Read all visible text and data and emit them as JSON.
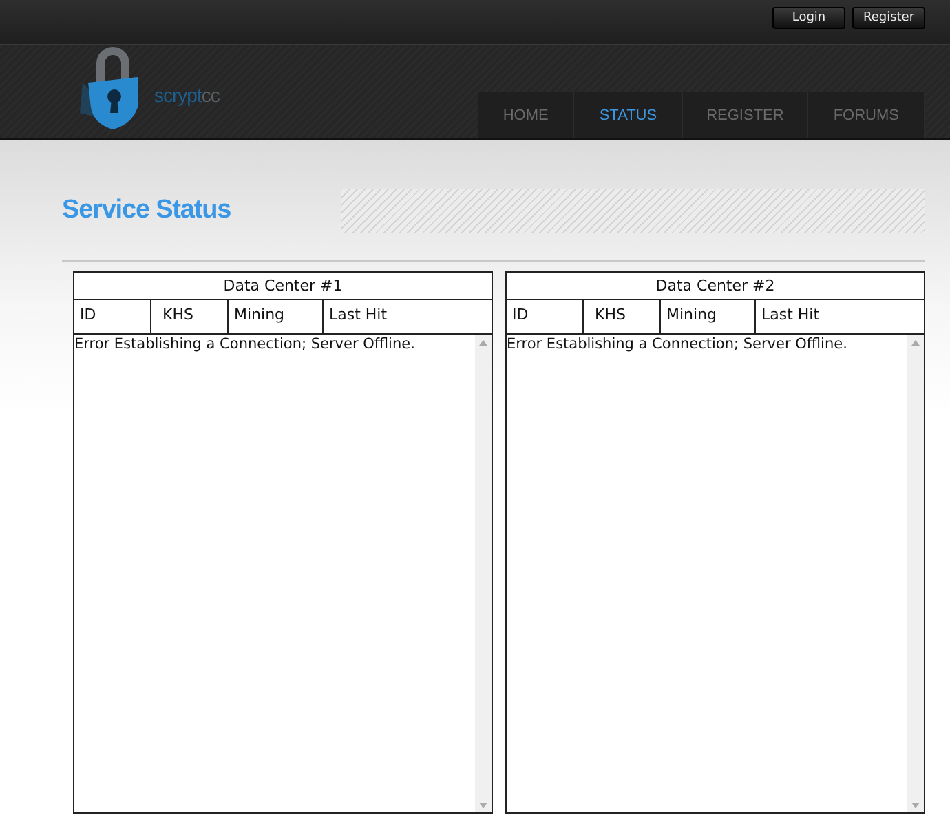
{
  "top_bar": {
    "buttons": [
      "Login",
      "Register"
    ]
  },
  "logo": {
    "name_main": "scrypt",
    "name_accent": "cc"
  },
  "nav": [
    {
      "label": "HOME",
      "selected": false
    },
    {
      "label": "STATUS",
      "selected": true
    },
    {
      "label": "REGISTER",
      "selected": false
    },
    {
      "label": "FORUMS",
      "selected": false
    }
  ],
  "page_title": "Service Status",
  "data_centers": [
    {
      "title": "Data Center #1",
      "columns": [
        "ID",
        "KHS",
        "Mining",
        "Last Hit"
      ],
      "message": "Error Establishing a Connection; Server Offline."
    },
    {
      "title": "Data Center #2",
      "columns": [
        "ID",
        "KHS",
        "Mining",
        "Last Hit"
      ],
      "message": "Error Establishing a Connection; Server Offline."
    }
  ]
}
